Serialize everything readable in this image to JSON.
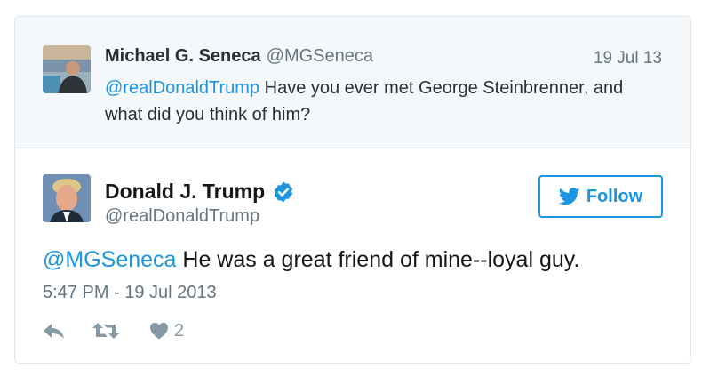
{
  "parent_tweet": {
    "name": "Michael G. Seneca",
    "handle": "@MGSeneca",
    "date": "19 Jul 13",
    "mention": "@realDonaldTrump",
    "text": " Have you ever met George Steinbrenner, and what did you think of him?"
  },
  "main_tweet": {
    "name": "Donald J. Trump",
    "handle": "@realDonaldTrump",
    "mention": "@MGSeneca",
    "text": " He was a great friend of mine--loyal guy.",
    "timestamp": "5:47 PM - 19 Jul 2013",
    "like_count": "2"
  },
  "follow_button": {
    "label": "Follow"
  },
  "icons": {
    "verified": "verified-badge-icon",
    "twitter_bird": "twitter-bird-icon",
    "reply": "reply-icon",
    "retweet": "retweet-icon",
    "like": "heart-icon"
  },
  "colors": {
    "accent": "#1b95e0",
    "muted": "#66757f",
    "action_gray": "#8899a6",
    "parent_bg": "#f5f8fa",
    "border": "#e1e8ed"
  }
}
